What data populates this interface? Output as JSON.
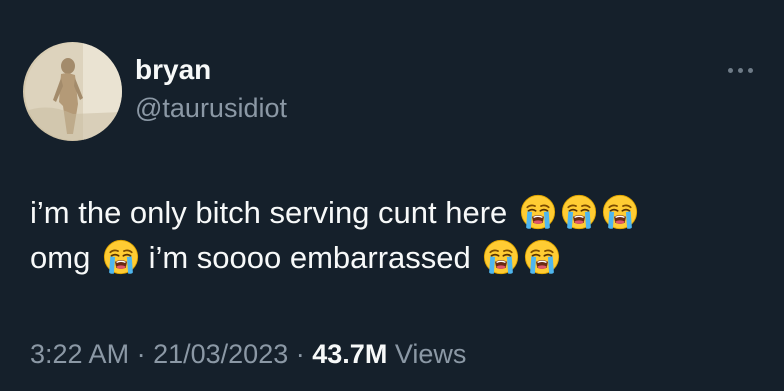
{
  "author": {
    "display_name": "bryan",
    "handle": "@taurusidiot"
  },
  "tweet": {
    "line1_text": "i’m the only bitch serving cunt here",
    "line2_part1": "omg",
    "line2_part2": "i’m soooo embarrassed",
    "emoji_name": "loudly-crying-face"
  },
  "meta": {
    "time": "3:22 AM",
    "separator": "·",
    "date": "21/03/2023",
    "views_count": "43.7M",
    "views_label": "Views"
  },
  "icons": {
    "more": "more-horizontal-icon"
  },
  "colors": {
    "background": "#15202b",
    "primary_text": "#f7f9f9",
    "secondary_text": "#8b98a5"
  }
}
